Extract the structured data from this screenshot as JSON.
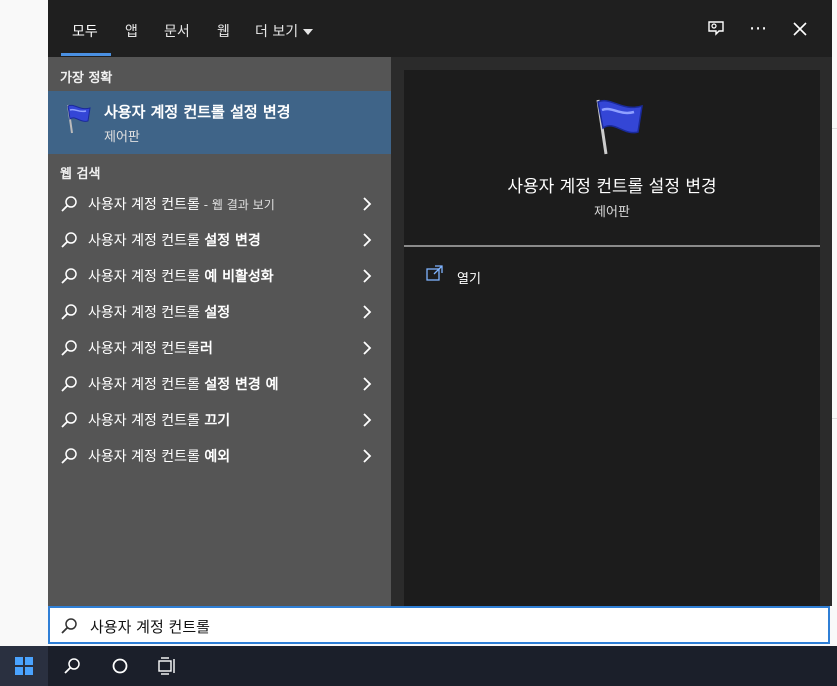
{
  "tabs": [
    {
      "label": "모두",
      "active": true
    },
    {
      "label": "앱"
    },
    {
      "label": "문서"
    },
    {
      "label": "웹"
    },
    {
      "label": "더 보기"
    }
  ],
  "left": {
    "best_match_title": "가장 정확",
    "best_match": {
      "title": "사용자 계정 컨트롤 설정 변경",
      "subtitle": "제어판"
    },
    "web_title": "웹 검색",
    "web_results": [
      {
        "base": "사용자 계정 컨트롤",
        "suffix": "",
        "note": " - 웹 결과 보기"
      },
      {
        "base": "사용자 계정 컨트롤 ",
        "suffix": "설정 변경",
        "note": ""
      },
      {
        "base": "사용자 계정 컨트롤 ",
        "suffix": "예 비활성화",
        "note": ""
      },
      {
        "base": "사용자 계정 컨트롤 ",
        "suffix": "설정",
        "note": ""
      },
      {
        "base": "사용자 계정 컨트롤",
        "suffix": "러",
        "note": ""
      },
      {
        "base": "사용자 계정 컨트롤 ",
        "suffix": "설정 변경 예",
        "note": ""
      },
      {
        "base": "사용자 계정 컨트롤 ",
        "suffix": "끄기",
        "note": ""
      },
      {
        "base": "사용자 계정 컨트롤 ",
        "suffix": "예외",
        "note": ""
      }
    ]
  },
  "right": {
    "title": "사용자 계정 컨트롤 설정 변경",
    "subtitle": "제어판",
    "open_label": "열기"
  },
  "search": {
    "value": "사용자 계정 컨트롤"
  },
  "colors": {
    "accent": "#4a90e2",
    "best_match_bg": "#3f6488",
    "search_border": "#2f7fd6"
  },
  "icons": {
    "best_match": "uac-flag-icon",
    "web_result": "search-icon",
    "chevron": "chevron-right-icon",
    "open": "open-external-icon",
    "feedback": "feedback-icon",
    "more": "more-options-icon",
    "close": "close-icon",
    "start": "windows-start-icon",
    "taskbar_search": "search-icon",
    "cortana": "cortana-icon",
    "task_view": "task-view-icon"
  }
}
